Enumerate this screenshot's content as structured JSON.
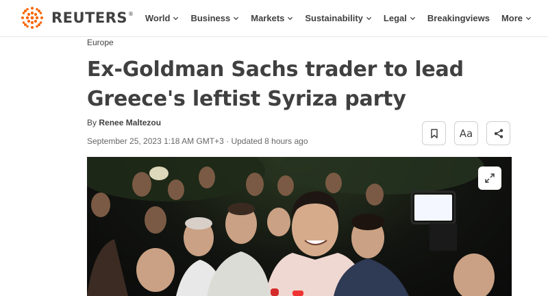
{
  "brand": {
    "name": "REUTERS",
    "mark": "®"
  },
  "nav": {
    "items": [
      {
        "label": "World"
      },
      {
        "label": "Business"
      },
      {
        "label": "Markets"
      },
      {
        "label": "Sustainability"
      },
      {
        "label": "Legal"
      },
      {
        "label": "Breakingviews"
      },
      {
        "label": "More"
      }
    ]
  },
  "article": {
    "kicker": "Europe",
    "headline": "Ex-Goldman Sachs trader to lead Greece's leftist Syriza party",
    "byline_prefix": "By",
    "author": "Renee Maltezou",
    "dateline": "September 25, 2023 1:18 AM GMT+3 · Updated 8 hours ago",
    "text_size_label": "Aa"
  },
  "colors": {
    "accent": "#fa6400",
    "text": "#404040"
  },
  "icons": {
    "bookmark": "bookmark-icon",
    "share": "share-icon",
    "expand": "expand-icon",
    "chevron": "chevron-down-icon"
  }
}
